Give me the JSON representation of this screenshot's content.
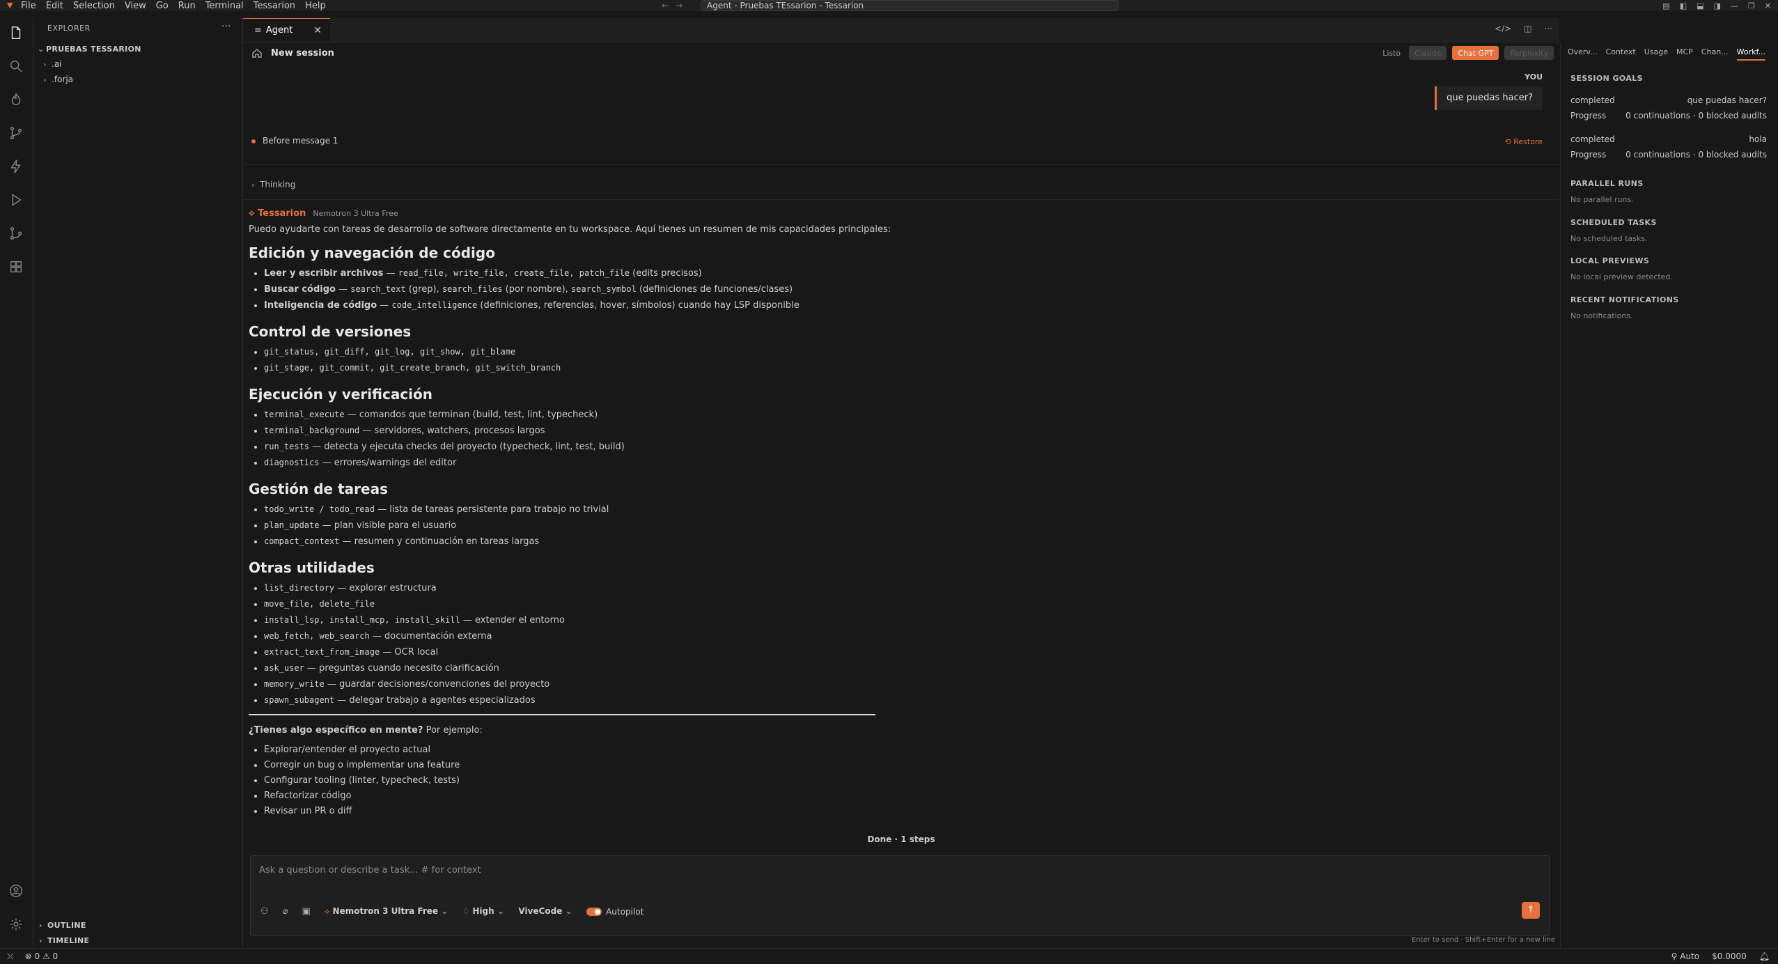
{
  "menubar": {
    "items": [
      "File",
      "Edit",
      "Selection",
      "View",
      "Go",
      "Run",
      "Terminal",
      "Tessarion",
      "Help"
    ],
    "title": "Agent - Pruebas TEssarion - Tessarion"
  },
  "explorer": {
    "header": "EXPLORER",
    "root": "PRUEBAS TESSARION",
    "items": [
      ".ai",
      ".forja"
    ],
    "outline": "OUTLINE",
    "timeline": "TIMELINE"
  },
  "tab": {
    "label": "Agent"
  },
  "session": {
    "title": "New session",
    "status": "Listo",
    "providers": [
      "Claude",
      "Chat GPT",
      "Perplexity"
    ],
    "active_provider": "Chat GPT"
  },
  "chat": {
    "you_label": "YOU",
    "user_message": "que puedas hacer?",
    "checkpoint": "Before message 1",
    "restore": "Restore",
    "thinking": "Thinking",
    "agent_name": "Tessarion",
    "agent_model": "Nemotron 3 Ultra Free",
    "intro": "Puedo ayudarte con tareas de desarrollo de software directamente en tu workspace. Aquí tienes un resumen de mis capacidades principales:",
    "sections": [
      {
        "title": "Edición y navegación de código",
        "items": [
          {
            "bold": "Leer y escribir archivos",
            "sep": " — ",
            "code": "read_file, write_file, create_file, patch_file",
            "text": " (edits precisos)"
          },
          {
            "bold": "Buscar código",
            "sep": " — ",
            "code": "search_text",
            "text": " (grep), ",
            "code2": "search_files",
            "text2": " (por nombre), ",
            "code3": "search_symbol",
            "text3": " (definiciones de funciones/clases)"
          },
          {
            "bold": "Inteligencia de código",
            "sep": " — ",
            "code": "code_intelligence",
            "text": " (definiciones, referencias, hover, símbolos) cuando hay LSP disponible"
          }
        ]
      },
      {
        "title": "Control de versiones",
        "items": [
          {
            "code": "git_status, git_diff, git_log, git_show, git_blame"
          },
          {
            "code": "git_stage, git_commit, git_create_branch, git_switch_branch"
          }
        ]
      },
      {
        "title": "Ejecución y verificación",
        "items": [
          {
            "code": "terminal_execute",
            "text": " — comandos que terminan (build, test, lint, typecheck)"
          },
          {
            "code": "terminal_background",
            "text": " — servidores, watchers, procesos largos"
          },
          {
            "code": "run_tests",
            "text": " — detecta y ejecuta checks del proyecto (typecheck, lint, test, build)"
          },
          {
            "code": "diagnostics",
            "text": " — errores/warnings del editor"
          }
        ]
      },
      {
        "title": "Gestión de tareas",
        "items": [
          {
            "code": "todo_write / todo_read",
            "text": " — lista de tareas persistente para trabajo no trivial"
          },
          {
            "code": "plan_update",
            "text": " — plan visible para el usuario"
          },
          {
            "code": "compact_context",
            "text": " — resumen y continuación en tareas largas"
          }
        ]
      },
      {
        "title": "Otras utilidades",
        "items": [
          {
            "code": "list_directory",
            "text": " — explorar estructura"
          },
          {
            "code": "move_file, delete_file",
            "text": ""
          },
          {
            "code": "install_lsp, install_mcp, install_skill",
            "text": " — extender el entorno"
          },
          {
            "code": "web_fetch, web_search",
            "text": " — documentación externa"
          },
          {
            "code": "extract_text_from_image",
            "text": " — OCR local"
          },
          {
            "code": "ask_user",
            "text": " — preguntas cuando necesito clarificación"
          },
          {
            "code": "memory_write",
            "text": " — guardar decisiones/convenciones del proyecto"
          },
          {
            "code": "spawn_subagent",
            "text": " — delegar trabajo a agentes especializados"
          }
        ]
      }
    ],
    "closing_bold": "¿Tienes algo específico en mente?",
    "closing_text": " Por ejemplo:",
    "examples": [
      "Explorar/entender el proyecto actual",
      "Corregir un bug o implementar una feature",
      "Configurar tooling (linter, typecheck, tests)",
      "Refactorizar código",
      "Revisar un PR o diff"
    ],
    "done": "Done · 1 steps"
  },
  "composer": {
    "placeholder": "Ask a question or describe a task... # for context",
    "model": "Nemotron 3 Ultra Free",
    "effort": "High",
    "mode": "ViveCode",
    "autopilot": "Autopilot",
    "hint": "Enter to send · Shift+Enter for a new line"
  },
  "right_panel": {
    "tabs": [
      "Overv...",
      "Context",
      "Usage",
      "MCP",
      "Chan...",
      "Workf..."
    ],
    "active_tab": "Workf...",
    "session_goals_title": "SESSION GOALS",
    "goals": [
      {
        "status": "completed",
        "name": "que puedas hacer?",
        "progress_label": "Progress",
        "progress": "0 continuations · 0 blocked audits"
      },
      {
        "status": "completed",
        "name": "hola",
        "progress_label": "Progress",
        "progress": "0 continuations · 0 blocked audits"
      }
    ],
    "parallel_title": "PARALLEL RUNS",
    "parallel_empty": "No parallel runs.",
    "scheduled_title": "SCHEDULED TASKS",
    "scheduled_empty": "No scheduled tasks.",
    "previews_title": "LOCAL PREVIEWS",
    "previews_empty": "No local preview detected.",
    "notifications_title": "RECENT NOTIFICATIONS",
    "notifications_empty": "No notifications."
  },
  "statusbar": {
    "errors": "0",
    "warnings": "0",
    "auto": "Auto",
    "cost": "$0.0000"
  },
  "colors": {
    "accent": "#e8703a",
    "background": "#181818"
  }
}
